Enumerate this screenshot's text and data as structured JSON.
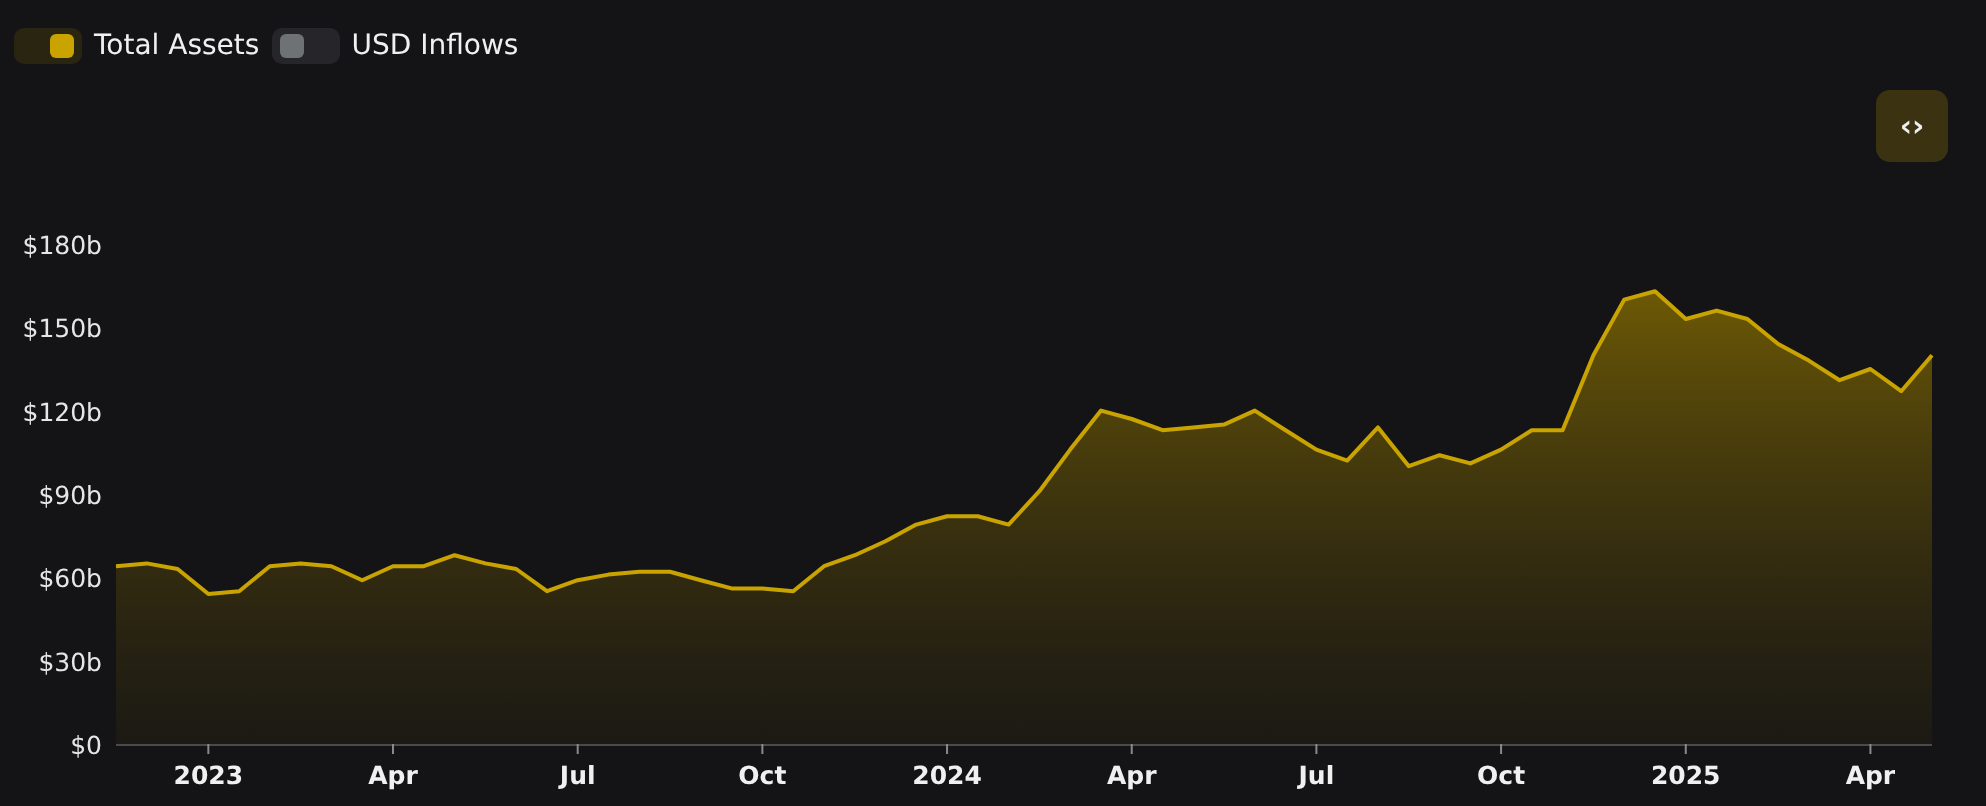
{
  "legend": [
    {
      "label": "Total Assets",
      "selected": true
    },
    {
      "label": "USD Inflows",
      "selected": false
    }
  ],
  "embed_button": {
    "label": "‹›"
  },
  "chart": {
    "chart_data": {
      "type": "area",
      "categories": [
        null,
        null,
        null,
        "2023",
        null,
        null,
        null,
        null,
        null,
        "Apr",
        null,
        null,
        null,
        null,
        null,
        "Jul",
        null,
        null,
        null,
        null,
        null,
        "Oct",
        null,
        null,
        null,
        null,
        null,
        "2024",
        null,
        null,
        null,
        null,
        null,
        "Apr",
        null,
        null,
        null,
        null,
        null,
        "Jul",
        null,
        null,
        null,
        null,
        null,
        "Oct",
        null,
        null,
        null,
        null,
        null,
        "2025",
        null,
        null,
        null,
        null,
        null,
        "Apr",
        null,
        null
      ],
      "series": [
        {
          "color": "#c9a300",
          "values": [
            64,
            65,
            63,
            54,
            55,
            64,
            65,
            64,
            59,
            64,
            64,
            68,
            65,
            63,
            55,
            59,
            61,
            62,
            62,
            59,
            56,
            56,
            55,
            64,
            68,
            73,
            79,
            82,
            82,
            79,
            91,
            106,
            120,
            117,
            113,
            114,
            115,
            120,
            113,
            106,
            102,
            114,
            100,
            104,
            101,
            106,
            113,
            113,
            140,
            160,
            163,
            153,
            156,
            153,
            144,
            138,
            131,
            135,
            127,
            140
          ]
        }
      ],
      "ylim": [
        0,
        180
      ],
      "yticks": [
        {
          "value": 0,
          "label": "$0"
        },
        {
          "value": 30,
          "label": "$30b"
        },
        {
          "value": 60,
          "label": "$60b"
        },
        {
          "value": 90,
          "label": "$90b"
        },
        {
          "value": 120,
          "label": "$120b"
        },
        {
          "value": 150,
          "label": "$150b"
        },
        {
          "value": 180,
          "label": "$180b"
        }
      ]
    }
  }
}
